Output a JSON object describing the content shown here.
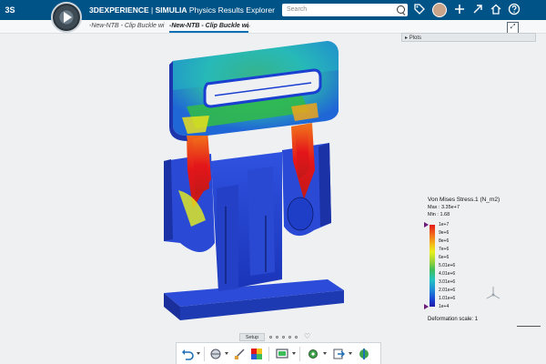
{
  "app": {
    "title_brand": "3DEXPERIENCE",
    "title_sep": " | ",
    "title_app": "SIMULIA",
    "title_rest": " Physics Results Explorer",
    "ds_logo_text": "3S"
  },
  "search": {
    "placeholder": "Search"
  },
  "tabs": [
    {
      "label": "-New-NTB - Clip Buckle wi"
    },
    {
      "label": "-New-NTB - Clip Buckle wi"
    }
  ],
  "plots_panel": {
    "label": "Plots"
  },
  "legend": {
    "title": "Von Mises Stress.1 (N_m2)",
    "max": "Max : 3.35e+7",
    "min": "Min : 1.68",
    "ticks": [
      "1e+7",
      "9e+6",
      "8e+6",
      "7e+6",
      "6e+6",
      "5.01e+6",
      "4.01e+6",
      "3.01e+6",
      "2.01e+6",
      "1.01e+6",
      "1e+4"
    ]
  },
  "deformation": {
    "label": "Deformation scale: 1"
  },
  "setup": {
    "label": "Setup"
  },
  "colors": {
    "topbar": "#005386",
    "accent": "#0a6fb3",
    "model_base": "#1f3fd6",
    "stress_high": "#e41a1c"
  },
  "icons": {
    "search": "search-icon",
    "tag": "tag-icon",
    "add": "plus-icon",
    "share": "share-icon",
    "home": "home-icon",
    "help": "help-icon"
  }
}
